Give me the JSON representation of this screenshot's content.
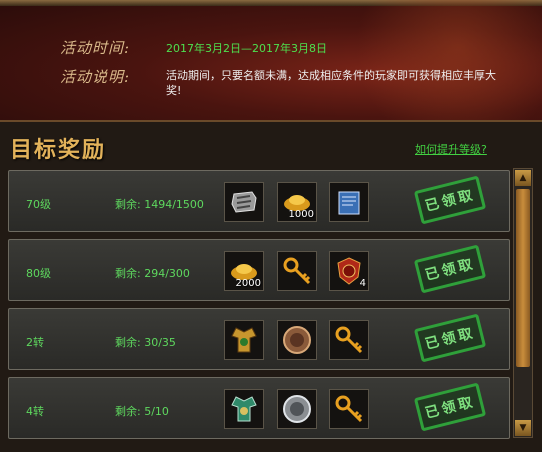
{
  "event": {
    "time_label": "活动时间:",
    "time_value": "2017年3月2日—2017年3月8日",
    "desc_label": "活动说明:",
    "desc_value": "活动期间，只要名额未满，达成相应条件的玩家即可获得相应丰厚大奖!"
  },
  "rewards": {
    "title": "目标奖励",
    "help_link": "如何提升等级?",
    "claimed_label": "已领取",
    "rows": [
      {
        "level": "70级",
        "remaining": "剩余: 1494/1500",
        "items": [
          {
            "icon": "armor-bracer-icon",
            "count": ""
          },
          {
            "icon": "gold-ingot-icon",
            "count": "1000"
          },
          {
            "icon": "scroll-book-icon",
            "count": ""
          }
        ]
      },
      {
        "level": "80级",
        "remaining": "剩余: 294/300",
        "items": [
          {
            "icon": "gold-ingot-icon",
            "count": "2000"
          },
          {
            "icon": "golden-key-icon",
            "count": ""
          },
          {
            "icon": "red-emblem-icon",
            "count": "4"
          }
        ]
      },
      {
        "level": "2转",
        "remaining": "剩余: 30/35",
        "items": [
          {
            "icon": "golden-armor-icon",
            "count": ""
          },
          {
            "icon": "bronze-medal-icon",
            "count": ""
          },
          {
            "icon": "golden-key-icon",
            "count": ""
          }
        ]
      },
      {
        "level": "4转",
        "remaining": "剩余: 5/10",
        "items": [
          {
            "icon": "jade-armor-icon",
            "count": ""
          },
          {
            "icon": "silver-medal-icon",
            "count": ""
          },
          {
            "icon": "golden-key-icon",
            "count": ""
          }
        ]
      }
    ]
  },
  "colors": {
    "accent_green": "#5ed85e",
    "title_gold": "#e2b25a",
    "stamp_green": "#2fa03a"
  }
}
